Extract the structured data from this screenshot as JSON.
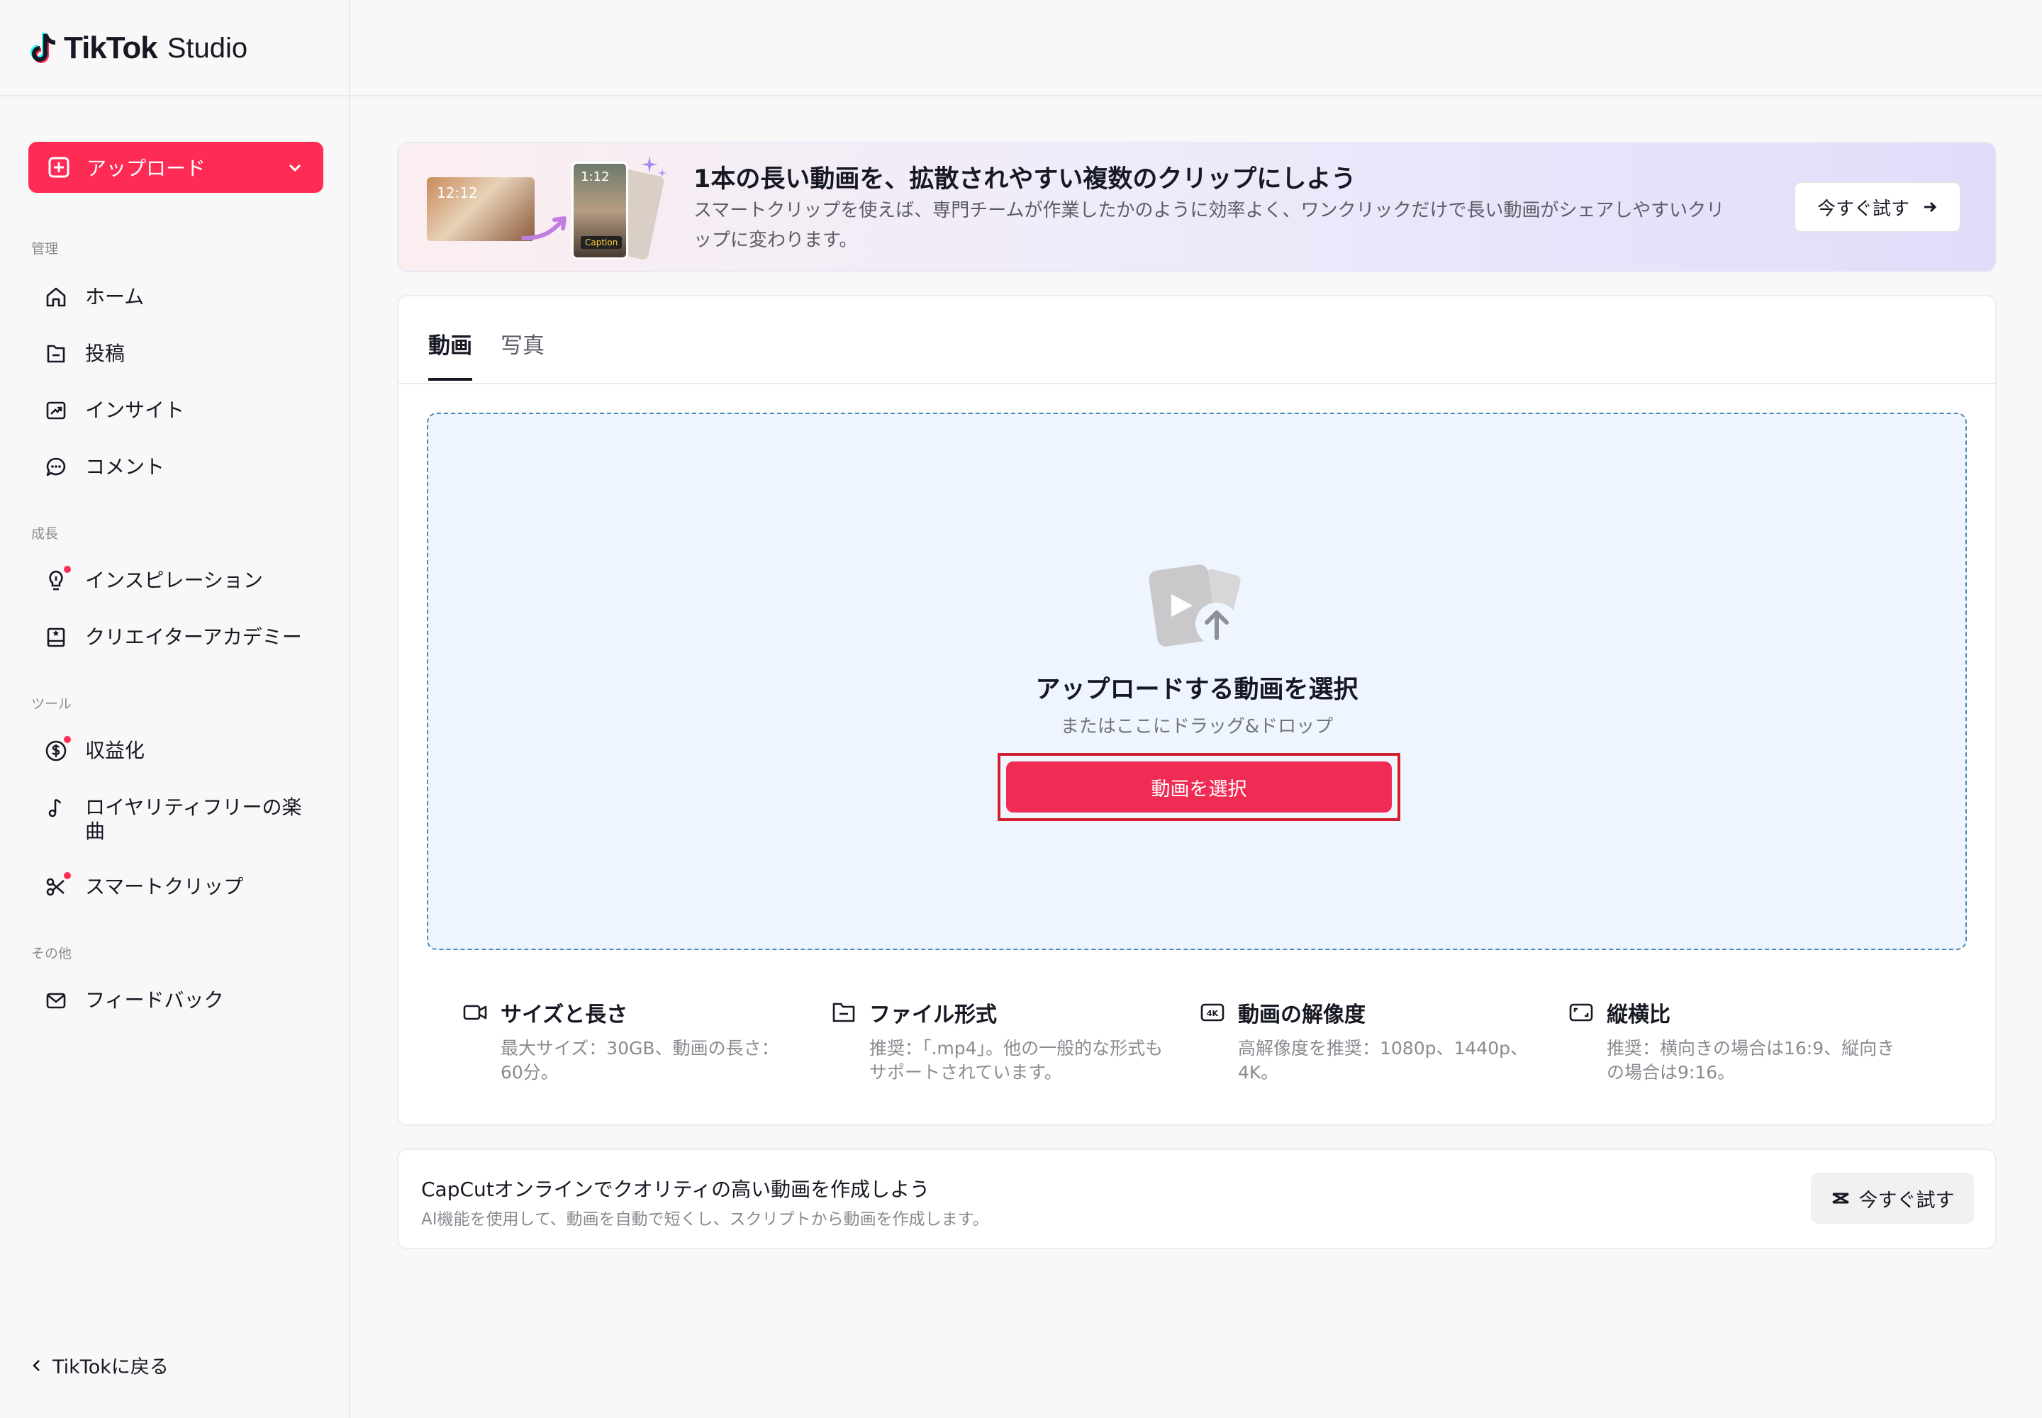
{
  "app": {
    "logo_bold": "TikTok",
    "logo_light": "Studio",
    "accent_color": "#fe2c55"
  },
  "sidebar": {
    "upload_label": "アップロード",
    "sections": [
      {
        "label": "管理"
      },
      {
        "label": "成長"
      },
      {
        "label": "ツール"
      },
      {
        "label": "その他"
      }
    ],
    "items": [
      {
        "label": "ホーム",
        "icon": "home-icon"
      },
      {
        "label": "投稿",
        "icon": "posts-icon"
      },
      {
        "label": "インサイト",
        "icon": "insights-icon"
      },
      {
        "label": "コメント",
        "icon": "comment-icon"
      },
      {
        "label": "インスピレーション",
        "icon": "lightbulb-icon",
        "badge": true
      },
      {
        "label": "クリエイターアカデミー",
        "icon": "academy-icon"
      },
      {
        "label": "収益化",
        "icon": "dollar-icon",
        "badge": true
      },
      {
        "label": "ロイヤリティフリーの楽曲",
        "icon": "music-note-icon"
      },
      {
        "label": "スマートクリップ",
        "icon": "scissors-icon",
        "badge": true
      },
      {
        "label": "フィードバック",
        "icon": "mail-icon"
      }
    ],
    "back_label": "TikTokに戻る"
  },
  "banner": {
    "thumb1_time": "12:12",
    "thumb2_time": "1:12",
    "thumb2_caption": "Caption",
    "title": "1本の長い動画を、拡散されやすい複数のクリップにしよう",
    "description": "スマートクリップを使えば、専門チームが作業したかのように効率よく、ワンクリックだけで長い動画がシェアしやすいクリップに変わります。",
    "button_label": "今すぐ試す"
  },
  "upload": {
    "tabs": [
      {
        "label": "動画",
        "active": true
      },
      {
        "label": "写真",
        "active": false
      }
    ],
    "dropzone_title": "アップロードする動画を選択",
    "dropzone_subtitle": "またはここにドラッグ&ドロップ",
    "select_button": "動画を選択",
    "info": [
      {
        "title": "サイズと長さ",
        "desc": "最大サイズ：30GB、動画の長さ：60分。",
        "icon": "video-camera-icon"
      },
      {
        "title": "ファイル形式",
        "desc": "推奨：「.mp4」。他の一般的な形式もサポートされています。",
        "icon": "file-icon"
      },
      {
        "title": "動画の解像度",
        "desc": "高解像度を推奨：1080p、1440p、4K。",
        "icon": "4k-icon"
      },
      {
        "title": "縦横比",
        "desc": "推奨：横向きの場合は16:9、縦向きの場合は9:16。",
        "icon": "aspect-ratio-icon"
      }
    ]
  },
  "capcut": {
    "title": "CapCutオンラインでクオリティの高い動画を作成しよう",
    "description": "AI機能を使用して、動画を自動で短くし、スクリプトから動画を作成します。",
    "button_label": "今すぐ試す"
  }
}
